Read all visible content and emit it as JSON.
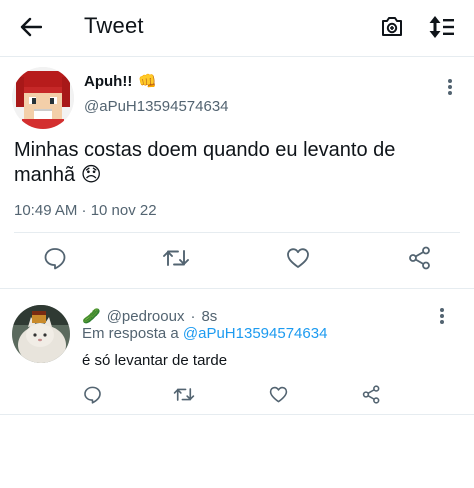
{
  "header": {
    "title": "Tweet",
    "back_icon": "arrow-left-icon",
    "camera_icon": "camera-icon",
    "sort_icon": "sort-icon"
  },
  "tweet": {
    "author_name": "Apuh!!",
    "author_emoji": "👊",
    "author_handle": "@aPuH13594574634",
    "text": "Minhas costas doem quando eu levanto de manhã",
    "text_emoji": "😞",
    "timestamp": "10:49 AM · 10 nov 22",
    "actions": [
      "reply-icon",
      "retweet-icon",
      "like-icon",
      "share-icon"
    ]
  },
  "reply": {
    "handle": "@pedrooux",
    "time_sep": "·",
    "time": "8s",
    "handle_emoji": "🥒",
    "reply_to_prefix": "Em resposta a",
    "reply_to_handle": "@aPuH13594574634",
    "text": "é só levantar de tarde",
    "actions": [
      "reply-icon",
      "retweet-icon",
      "like-icon",
      "share-icon"
    ]
  },
  "colors": {
    "text": "#0f1419",
    "secondary": "#536471",
    "link": "#1d9bf0",
    "divider": "#e6ecf0",
    "icon": "#536471"
  }
}
